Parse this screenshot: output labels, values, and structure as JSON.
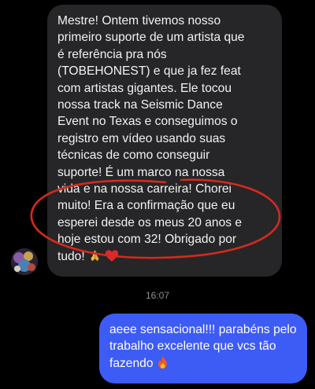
{
  "incoming_message": {
    "lines": [
      "Mestre! Ontem tivemos nosso",
      "primeiro suporte de um artista que",
      "é referência pra nós",
      "(TOBEHONEST) e que ja fez feat",
      "com artistas gigantes. Ele tocou",
      "nossa track na Seismic Dance",
      "Event no Texas e conseguimos o",
      "registro em vídeo usando suas",
      "técnicas de como conseguir",
      "suporte! É um marco na nossa",
      "vida e na nossa carreira! Chorei",
      "muito! Era a confirmação que eu",
      "esperei desde os meus 20 anos e",
      "hoje estou com 32! Obrigado por",
      "tudo!"
    ],
    "trailing_emojis": [
      "praying-hands",
      "red-heart"
    ]
  },
  "timestamp": "16:07",
  "outgoing_message": {
    "lines": [
      "aeee sensacional!!! parabéns pelo",
      "trabalho excelente que vcs tão",
      "fazendo"
    ],
    "trailing_emoji": "fire"
  },
  "colors": {
    "background": "#000000",
    "incoming_bubble": "#262628",
    "outgoing_bubble": "#3d5bf5",
    "annotation": "#d42a1e",
    "timestamp_text": "#8e8e93"
  }
}
